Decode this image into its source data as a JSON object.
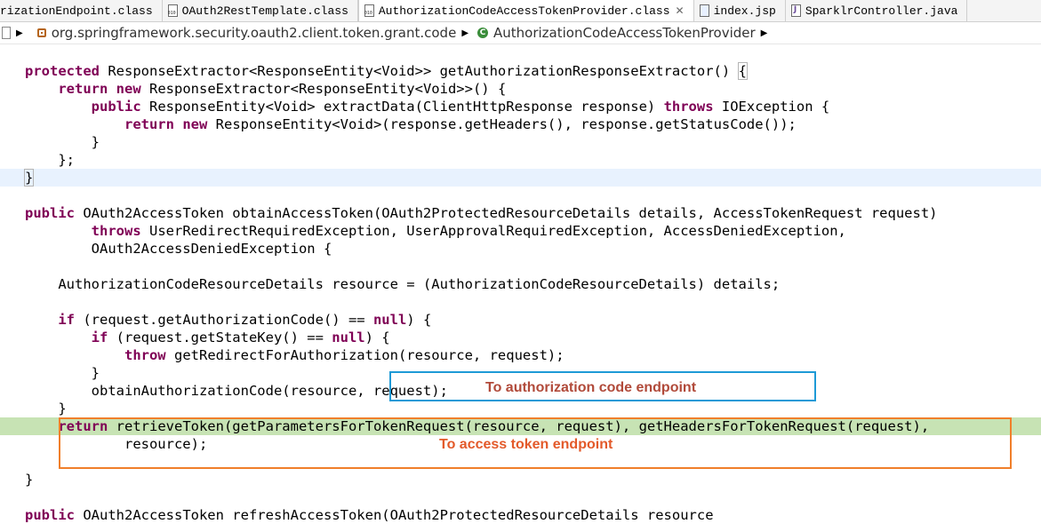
{
  "tabs": [
    {
      "label": "rizationEndpoint.class",
      "icon": "class-file-icon"
    },
    {
      "label": "OAuth2RestTemplate.class",
      "icon": "class-file-icon"
    },
    {
      "label": "AuthorizationCodeAccessTokenProvider.class",
      "icon": "class-file-icon",
      "active": true
    },
    {
      "label": "index.jsp",
      "icon": "jsp-file-icon"
    },
    {
      "label": "SparklrController.java",
      "icon": "java-file-icon"
    }
  ],
  "breadcrumb": {
    "package": "org.springframework.security.oauth2.client.token.grant.code",
    "class": "AuthorizationCodeAccessTokenProvider"
  },
  "code": {
    "l1": {
      "kw1": "protected",
      "rest": " ResponseExtractor<ResponseEntity<Void>> getAuthorizationResponseExtractor() ",
      "brace": "{"
    },
    "l2": {
      "indent": "    ",
      "kw1": "return",
      "sp": " ",
      "kw2": "new",
      "rest": " ResponseExtractor<ResponseEntity<Void>>() {"
    },
    "l3": {
      "indent": "        ",
      "kw1": "public",
      "mid": " ResponseEntity<Void> extractData(ClientHttpResponse response) ",
      "kw2": "throws",
      "rest": " IOException {"
    },
    "l4": {
      "indent": "            ",
      "kw1": "return",
      "sp": " ",
      "kw2": "new",
      "rest": " ResponseEntity<Void>(response.getHeaders(), response.getStatusCode());"
    },
    "l5": "        }",
    "l6": "    };",
    "l7": "}",
    "l9": {
      "kw1": "public",
      "rest": " OAuth2AccessToken obtainAccessToken(OAuth2ProtectedResourceDetails details, AccessTokenRequest request)"
    },
    "l10": {
      "indent": "        ",
      "kw1": "throws",
      "rest": " UserRedirectRequiredException, UserApprovalRequiredException, AccessDeniedException,"
    },
    "l11": "        OAuth2AccessDeniedException {",
    "l13": "    AuthorizationCodeResourceDetails resource = (AuthorizationCodeResourceDetails) details;",
    "l15": {
      "indent": "    ",
      "kw1": "if",
      "mid": " (request.getAuthorizationCode() == ",
      "kw2": "null",
      "rest": ") {"
    },
    "l16": {
      "indent": "        ",
      "kw1": "if",
      "mid": " (request.getStateKey() == ",
      "kw2": "null",
      "rest": ") {"
    },
    "l17": {
      "indent": "            ",
      "kw1": "throw",
      "rest": " getRedirectForAuthorization(resource, request);"
    },
    "l18": "        }",
    "l19": "        obtainAuthorizationCode(resource, request);",
    "l20": "    }",
    "l21": {
      "indent": "    ",
      "kw1": "return",
      "rest": " retrieveToken(getParametersForTokenRequest(resource, request), getHeadersForTokenRequest(request),"
    },
    "l22": "            resource);",
    "l24": "}",
    "l26": {
      "kw1": "public",
      "rest": " OAuth2AccessToken refreshAccessToken(OAuth2ProtectedResourceDetails resource"
    }
  },
  "annotations": {
    "auth_code": "To authorization code endpoint",
    "access_token": "To access token endpoint"
  },
  "colors": {
    "keyword": "#7f0055",
    "current_line": "#e8f2fe",
    "debug_line": "#c7e3b4",
    "blue_box": "#1e9ad6",
    "orange_box": "#f07f2a"
  }
}
